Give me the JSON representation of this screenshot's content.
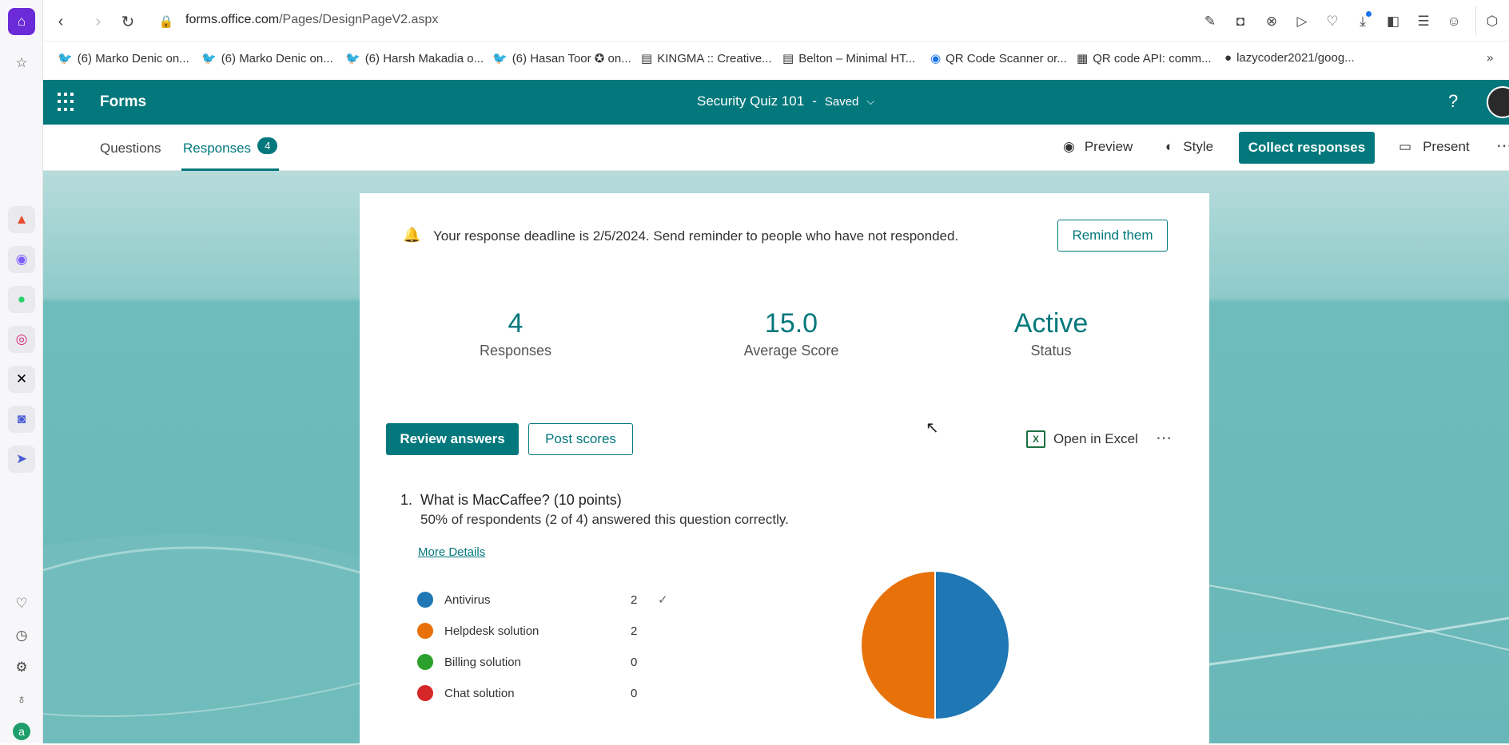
{
  "browser": {
    "url_domain": "forms.office.com",
    "url_path": "/Pages/DesignPageV2.aspx",
    "bookmarks": [
      {
        "label": "(6) Marko Denic on...",
        "icon": "twitter-icon",
        "color": "#1d9bf0"
      },
      {
        "label": "(6) Marko Denic on...",
        "icon": "twitter-icon",
        "color": "#1d9bf0"
      },
      {
        "label": "(6) Harsh Makadia o...",
        "icon": "twitter-icon",
        "color": "#1d9bf0"
      },
      {
        "label": "(6) Hasan Toor ✪ on...",
        "icon": "twitter-icon",
        "color": "#1d9bf0"
      },
      {
        "label": "KINGMA :: Creative...",
        "icon": "page-icon",
        "color": "#333333"
      },
      {
        "label": "Belton – Minimal HT...",
        "icon": "page-icon",
        "color": "#333333"
      },
      {
        "label": "QR Code Scanner or...",
        "icon": "qr-scanner-icon",
        "color": "#1a73e8"
      },
      {
        "label": "QR code API: comm...",
        "icon": "qr-code-icon",
        "color": "#222222"
      },
      {
        "label": "lazycoder2021/goog...",
        "icon": "github-icon",
        "color": "#222222"
      }
    ]
  },
  "forms": {
    "app_name": "Forms",
    "form_title": "Security Quiz 101",
    "separator": "-",
    "save_status": "Saved",
    "tabs": {
      "questions": "Questions",
      "responses": "Responses",
      "responses_count": "4"
    },
    "toolbar": {
      "preview": "Preview",
      "style": "Style",
      "collect": "Collect responses",
      "present": "Present"
    },
    "deadline_text": "Your response deadline is 2/5/2024. Send reminder to people who have not responded.",
    "remind_button": "Remind them",
    "stats": [
      {
        "value": "4",
        "label": "Responses"
      },
      {
        "value": "15.0",
        "label": "Average Score"
      },
      {
        "value": "Active",
        "label": "Status"
      }
    ],
    "review_button": "Review answers",
    "post_button": "Post scores",
    "excel_label": "Open in Excel",
    "question": {
      "number": "1.",
      "title": "What is MacCaffee? (10 points)",
      "summary": "50% of respondents (2 of 4) answered this question correctly.",
      "more_details": "More Details"
    }
  },
  "chart_data": {
    "type": "pie",
    "categories": [
      "Antivirus",
      "Helpdesk solution",
      "Billing solution",
      "Chat solution"
    ],
    "values": [
      2,
      2,
      0,
      0
    ],
    "colors": [
      "#1f77b4",
      "#e8710a",
      "#2ca02c",
      "#d62728"
    ],
    "correct": "Antivirus"
  }
}
